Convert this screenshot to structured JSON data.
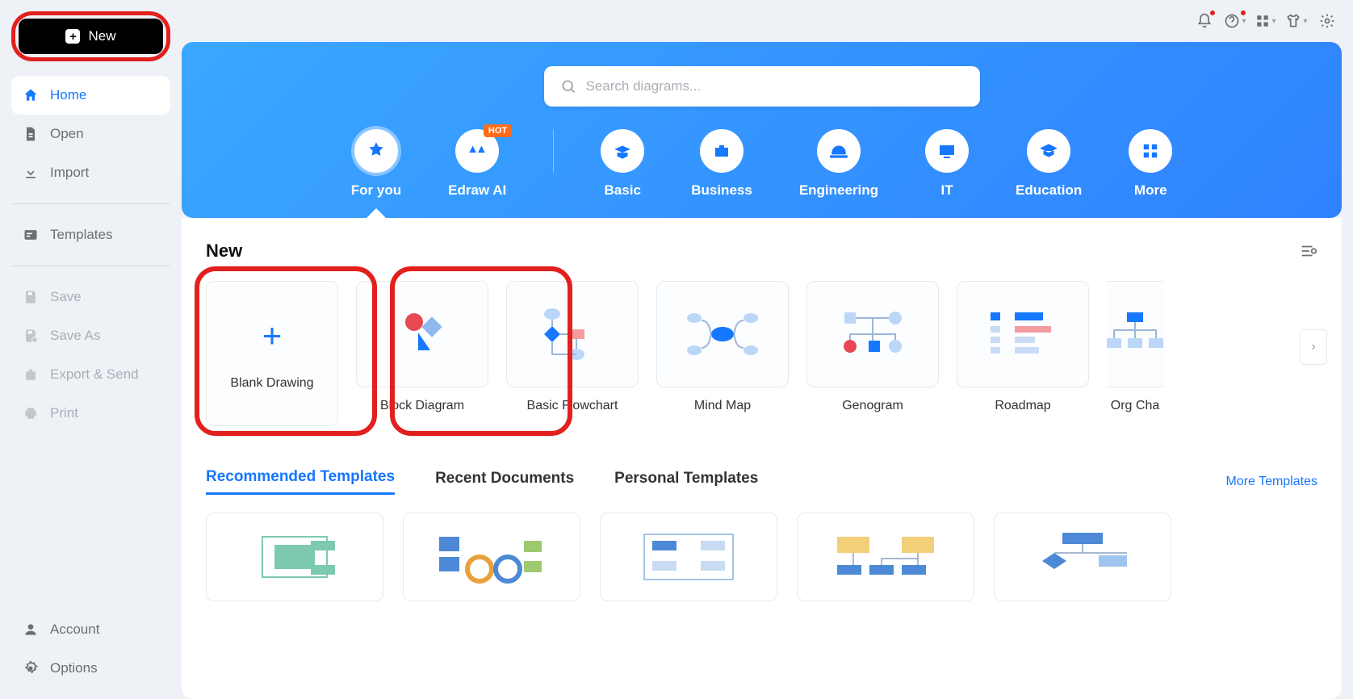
{
  "sidebar": {
    "new_label": "New",
    "items": [
      {
        "label": "Home"
      },
      {
        "label": "Open"
      },
      {
        "label": "Import"
      },
      {
        "label": "Templates"
      },
      {
        "label": "Save"
      },
      {
        "label": "Save As"
      },
      {
        "label": "Export & Send"
      },
      {
        "label": "Print"
      },
      {
        "label": "Account"
      },
      {
        "label": "Options"
      }
    ]
  },
  "search": {
    "placeholder": "Search diagrams..."
  },
  "categories": [
    {
      "label": "For you"
    },
    {
      "label": "Edraw AI",
      "hot": "HOT"
    },
    {
      "label": "Basic"
    },
    {
      "label": "Business"
    },
    {
      "label": "Engineering"
    },
    {
      "label": "IT"
    },
    {
      "label": "Education"
    },
    {
      "label": "More"
    }
  ],
  "section": {
    "new_heading": "New"
  },
  "templates": [
    {
      "label": "Blank Drawing"
    },
    {
      "label": "Block Diagram"
    },
    {
      "label": "Basic Flowchart"
    },
    {
      "label": "Mind Map"
    },
    {
      "label": "Genogram"
    },
    {
      "label": "Roadmap"
    },
    {
      "label": "Org Cha"
    }
  ],
  "tabs": {
    "recommended": "Recommended Templates",
    "recent": "Recent Documents",
    "personal": "Personal Templates",
    "more": "More Templates"
  }
}
